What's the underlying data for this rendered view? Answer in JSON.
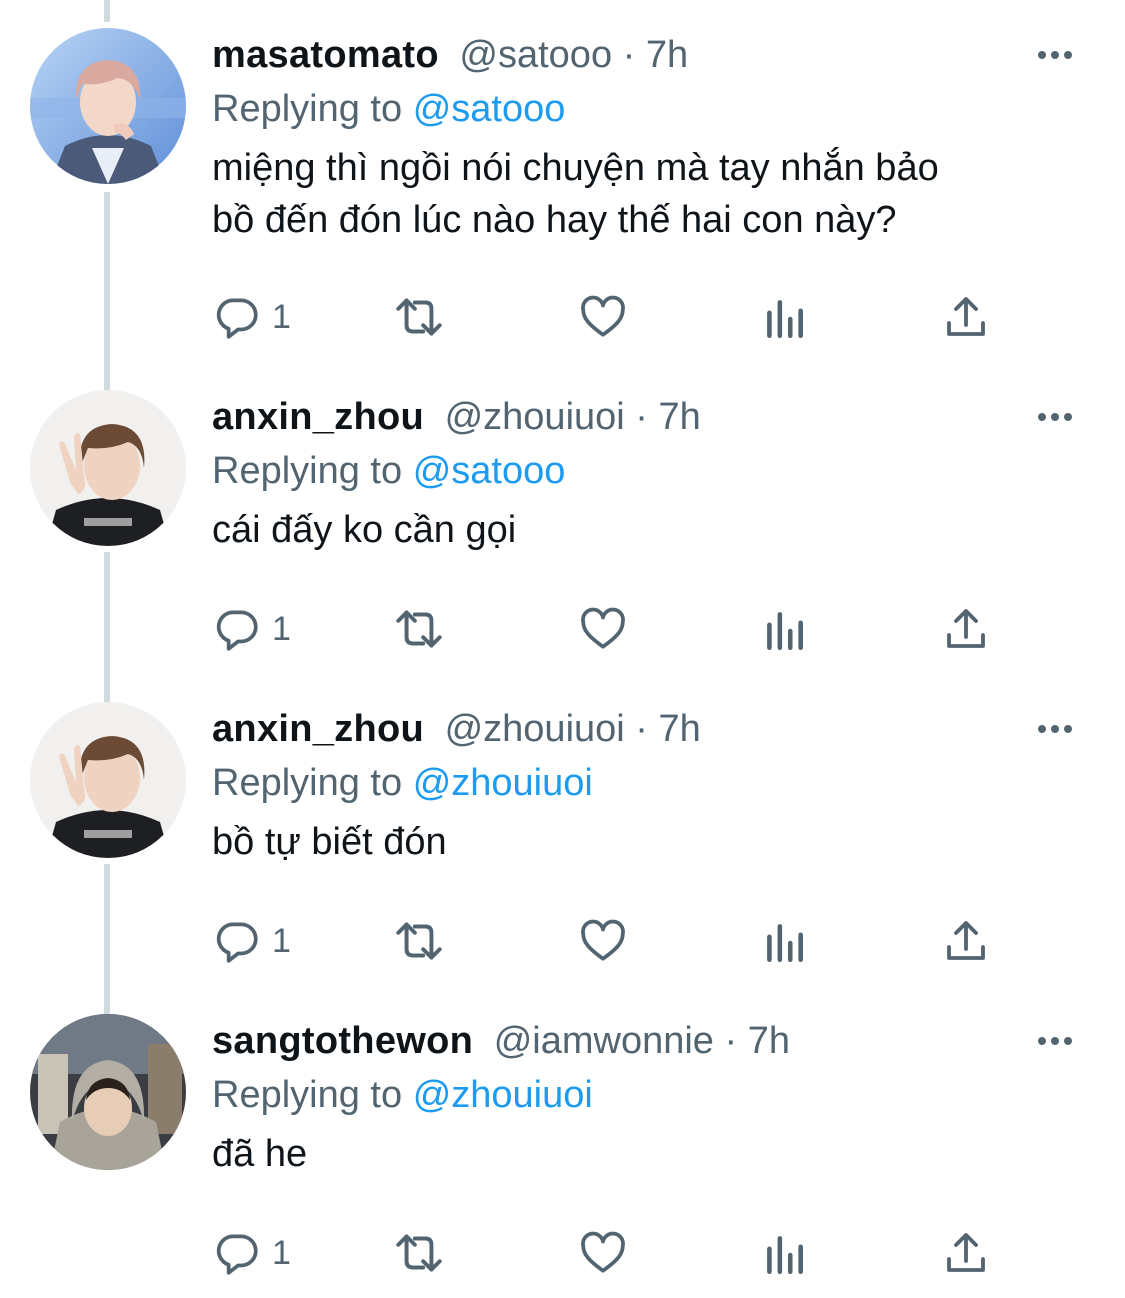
{
  "colors": {
    "text": "#0f1419",
    "secondary": "#536471",
    "link": "#1d9bf0",
    "thread_line": "#cfd9de"
  },
  "tweets": [
    {
      "display_name": "masatomato",
      "handle": "@satooo",
      "separator": "·",
      "time": "7h",
      "replying_prefix": "Replying to",
      "replying_to": "@satooo",
      "text_lines": [
        "miệng thì ngồi nói chuyện mà tay nhắn bảo",
        "bồ đến đón lúc nào hay thế hai con này?"
      ],
      "reply_count": "1",
      "avatar_icon": "avatar-masatomato"
    },
    {
      "display_name": "anxin_zhou",
      "handle": "@zhouiuoi",
      "separator": "·",
      "time": "7h",
      "replying_prefix": "Replying to",
      "replying_to": "@satooo",
      "text_lines": [
        "cái đấy ko cần gọi"
      ],
      "reply_count": "1",
      "avatar_icon": "avatar-anxin-zhou"
    },
    {
      "display_name": "anxin_zhou",
      "handle": "@zhouiuoi",
      "separator": "·",
      "time": "7h",
      "replying_prefix": "Replying to",
      "replying_to": "@zhouiuoi",
      "text_lines": [
        "bồ tự biết đón"
      ],
      "reply_count": "1",
      "avatar_icon": "avatar-anxin-zhou"
    },
    {
      "display_name": "sangtothewon",
      "handle": "@iamwonnie",
      "separator": "·",
      "time": "7h",
      "replying_prefix": "Replying to",
      "replying_to": "@zhouiuoi",
      "text_lines": [
        "đã he"
      ],
      "reply_count": "1",
      "avatar_icon": "avatar-sangtothewon"
    }
  ],
  "action_icons": [
    "reply-icon",
    "retweet-icon",
    "like-icon",
    "views-icon",
    "share-icon"
  ]
}
